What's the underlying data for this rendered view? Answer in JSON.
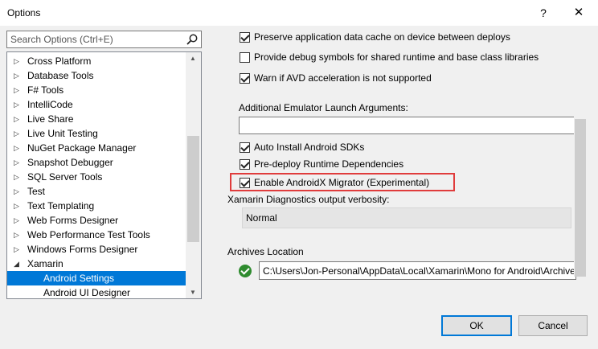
{
  "window": {
    "title": "Options",
    "help_label": "?",
    "close_label": "✕"
  },
  "search": {
    "placeholder": "Search Options (Ctrl+E)",
    "icon": "search-icon"
  },
  "tree": {
    "items": [
      {
        "label": "Cross Platform",
        "expandable": true
      },
      {
        "label": "Database Tools",
        "expandable": true
      },
      {
        "label": "F# Tools",
        "expandable": true
      },
      {
        "label": "IntelliCode",
        "expandable": true
      },
      {
        "label": "Live Share",
        "expandable": true
      },
      {
        "label": "Live Unit Testing",
        "expandable": true
      },
      {
        "label": "NuGet Package Manager",
        "expandable": true
      },
      {
        "label": "Snapshot Debugger",
        "expandable": true
      },
      {
        "label": "SQL Server Tools",
        "expandable": true
      },
      {
        "label": "Test",
        "expandable": true
      },
      {
        "label": "Text Templating",
        "expandable": true
      },
      {
        "label": "Web Forms Designer",
        "expandable": true
      },
      {
        "label": "Web Performance Test Tools",
        "expandable": true
      },
      {
        "label": "Windows Forms Designer",
        "expandable": true
      },
      {
        "label": "Xamarin",
        "expanded": true
      },
      {
        "label": "Android Settings",
        "child": true,
        "selected": true
      },
      {
        "label": "Android UI Designer",
        "child": true
      }
    ],
    "collapsed_arrow": "▷",
    "expanded_arrow": "◢"
  },
  "settings": {
    "preserve_cache": {
      "label": "Preserve application data cache on device between deploys",
      "checked": true
    },
    "debug_symbols": {
      "label": "Provide debug symbols for shared runtime and base class libraries",
      "checked": false
    },
    "avd_warn": {
      "label": "Warn if AVD acceleration is not supported",
      "checked": true
    },
    "emulator_args_label": "Additional Emulator Launch Arguments:",
    "emulator_args_value": "",
    "auto_install": {
      "label": "Auto Install Android SDKs",
      "checked": true
    },
    "predeploy": {
      "label": "Pre-deploy Runtime Dependencies",
      "checked": true
    },
    "androidx_migrator": {
      "label": "Enable AndroidX Migrator (Experimental)",
      "checked": true
    },
    "diagnostics_label": "Xamarin Diagnostics output verbosity:",
    "diagnostics_value": "Normal",
    "archives_label": "Archives Location",
    "archives_path": "C:\\Users\\Jon-Personal\\AppData\\Local\\Xamarin\\Mono for Android\\Archives"
  },
  "buttons": {
    "ok": "OK",
    "cancel": "Cancel"
  },
  "colors": {
    "selection": "#0078d7",
    "highlight_box": "#e03c3c",
    "valid_icon": "#2e8b2e"
  }
}
